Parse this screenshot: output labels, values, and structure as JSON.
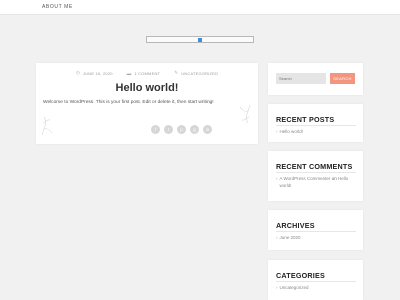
{
  "nav": {
    "about_label": "ABOUT ME"
  },
  "post": {
    "date": "JUNE 16, 2020",
    "comments": "1 COMMENT",
    "category": "UNCATEGORIZED",
    "title": "Hello world!",
    "content": "Welcome to WordPress. This is your first post. Edit or delete it, then start writing!",
    "share_icons": [
      "facebook-icon",
      "twitter-icon",
      "pinterest-icon",
      "google-plus-icon",
      "linkedin-icon"
    ],
    "share_glyphs": [
      "f",
      "t",
      "p",
      "g",
      "in"
    ]
  },
  "sidebar": {
    "search": {
      "placeholder": "Search",
      "button_label": "SEARCH"
    },
    "recent_posts": {
      "title": "RECENT POSTS",
      "items": [
        "Hello world!"
      ]
    },
    "recent_comments": {
      "title": "RECENT COMMENTS",
      "items": [
        {
          "author": "A WordPress Commenter",
          "connector": "on",
          "post": "Hello world!"
        }
      ]
    },
    "archives": {
      "title": "ARCHIVES",
      "items": [
        "June 2020"
      ]
    },
    "categories": {
      "title": "CATEGORIES",
      "items": [
        "Uncategorized"
      ]
    }
  },
  "colors": {
    "background": "#f1f1f1",
    "search_button": "#f2967e",
    "header_widget_dot": "#3c8ddb"
  }
}
